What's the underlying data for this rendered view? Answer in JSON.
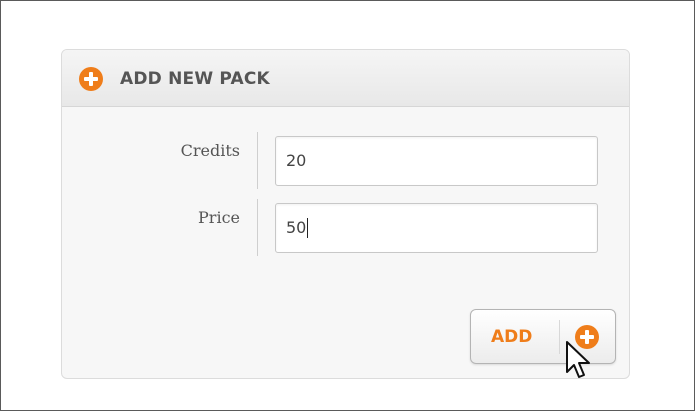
{
  "panel": {
    "title": "ADD NEW PACK",
    "header_icon": "plus-circle-icon"
  },
  "form": {
    "credits": {
      "label": "Credits",
      "value": "20"
    },
    "price": {
      "label": "Price",
      "value": "50"
    }
  },
  "actions": {
    "add_label": "ADD",
    "add_icon": "plus-circle-icon"
  },
  "colors": {
    "accent": "#ef7d1a",
    "text": "#555555",
    "panel_bg": "#f7f7f7"
  },
  "icons": {
    "cursor": "mouse-pointer-icon"
  }
}
